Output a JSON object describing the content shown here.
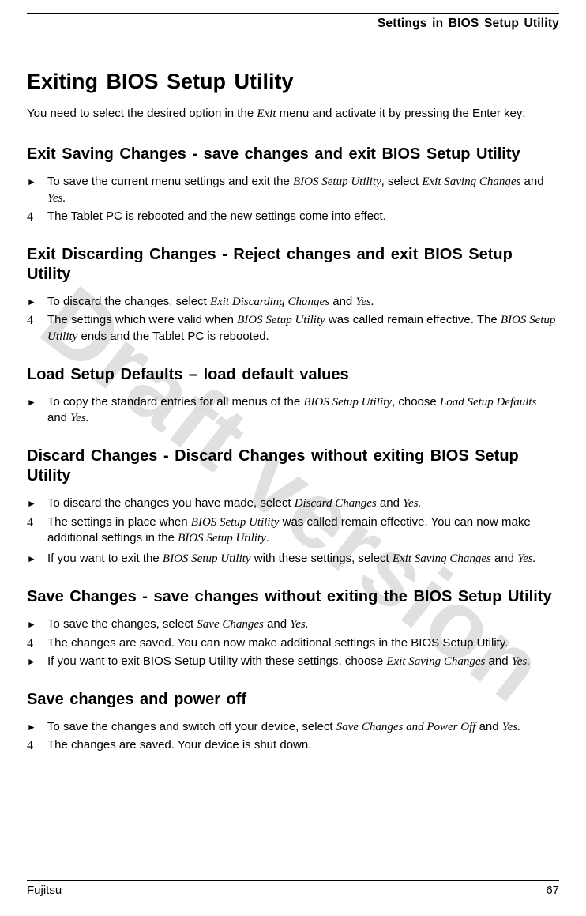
{
  "header": {
    "running_title": "Settings in BIOS Setup Utility"
  },
  "watermark": "Draft version",
  "title": "Exiting BIOS Setup Utility",
  "intro": {
    "pre": "You need to select the desired option in the ",
    "ital": "Exit",
    "post": " menu and activate it by pressing the Enter key:"
  },
  "sections": {
    "s1": {
      "title": "Exit Saving Changes - save changes and exit BIOS Setup Utility",
      "i1a": "To save the current menu settings and exit the ",
      "i1b": "BIOS Setup Utility",
      "i1c": ", select ",
      "i1d": "Exit Saving Changes",
      "i1e": " and ",
      "i1f": "Yes.",
      "i2": "The Tablet PC is rebooted and the new settings come into effect."
    },
    "s2": {
      "title": "Exit Discarding Changes - Reject changes and exit BIOS Setup Utility",
      "i1a": "To discard the changes, select ",
      "i1b": "Exit Discarding Changes",
      "i1c": " and ",
      "i1d": "Yes.",
      "i2a": "The settings which were valid when ",
      "i2b": "BIOS Setup Utility",
      "i2c": " was called remain effective. The ",
      "i2d": "BIOS Setup Utility",
      "i2e": " ends and the Tablet PC is rebooted."
    },
    "s3": {
      "title": "Load Setup Defaults – load default values",
      "i1a": "To copy the standard entries for all menus of the ",
      "i1b": "BIOS Setup Utility",
      "i1c": ", choose ",
      "i1d": "Load Setup Defaults",
      "i1e": " and ",
      "i1f": "Yes."
    },
    "s4": {
      "title": "Discard Changes - Discard Changes without exiting BIOS Setup Utility",
      "i1a": "To discard the changes you have made, select ",
      "i1b": "Discard Changes",
      "i1c": " and ",
      "i1d": "Yes.",
      "i2a": "The settings in place when ",
      "i2b": "BIOS Setup Utility",
      "i2c": " was called remain effective. You can now make additional settings in the ",
      "i2d": "BIOS Setup Utility",
      "i2e": ".",
      "i3a": "If you want to exit the ",
      "i3b": "BIOS Setup Utility",
      "i3c": " with these settings, select ",
      "i3d": "Exit Saving Changes",
      "i3e": " and ",
      "i3f": "Yes."
    },
    "s5": {
      "title": "Save Changes - save changes without exiting the BIOS Setup Utility",
      "i1a": "To save the changes, select ",
      "i1b": "Save Changes",
      "i1c": " and ",
      "i1d": "Yes.",
      "i2": "The changes are saved. You can now make additional settings in the BIOS Setup Utility.",
      "i3a": "If you want to exit BIOS Setup Utility with these settings, choose ",
      "i3b": "Exit Saving Changes",
      "i3c": " and ",
      "i3d": "Yes."
    },
    "s6": {
      "title": "Save changes and power off",
      "i1a": "To save the changes and switch off your device, select ",
      "i1b": "Save Changes and Power Off",
      "i1c": " and ",
      "i1d": "Yes.",
      "i2": "The changes are saved. Your device is shut down."
    }
  },
  "footer": {
    "left": "Fujitsu",
    "right": "67"
  }
}
